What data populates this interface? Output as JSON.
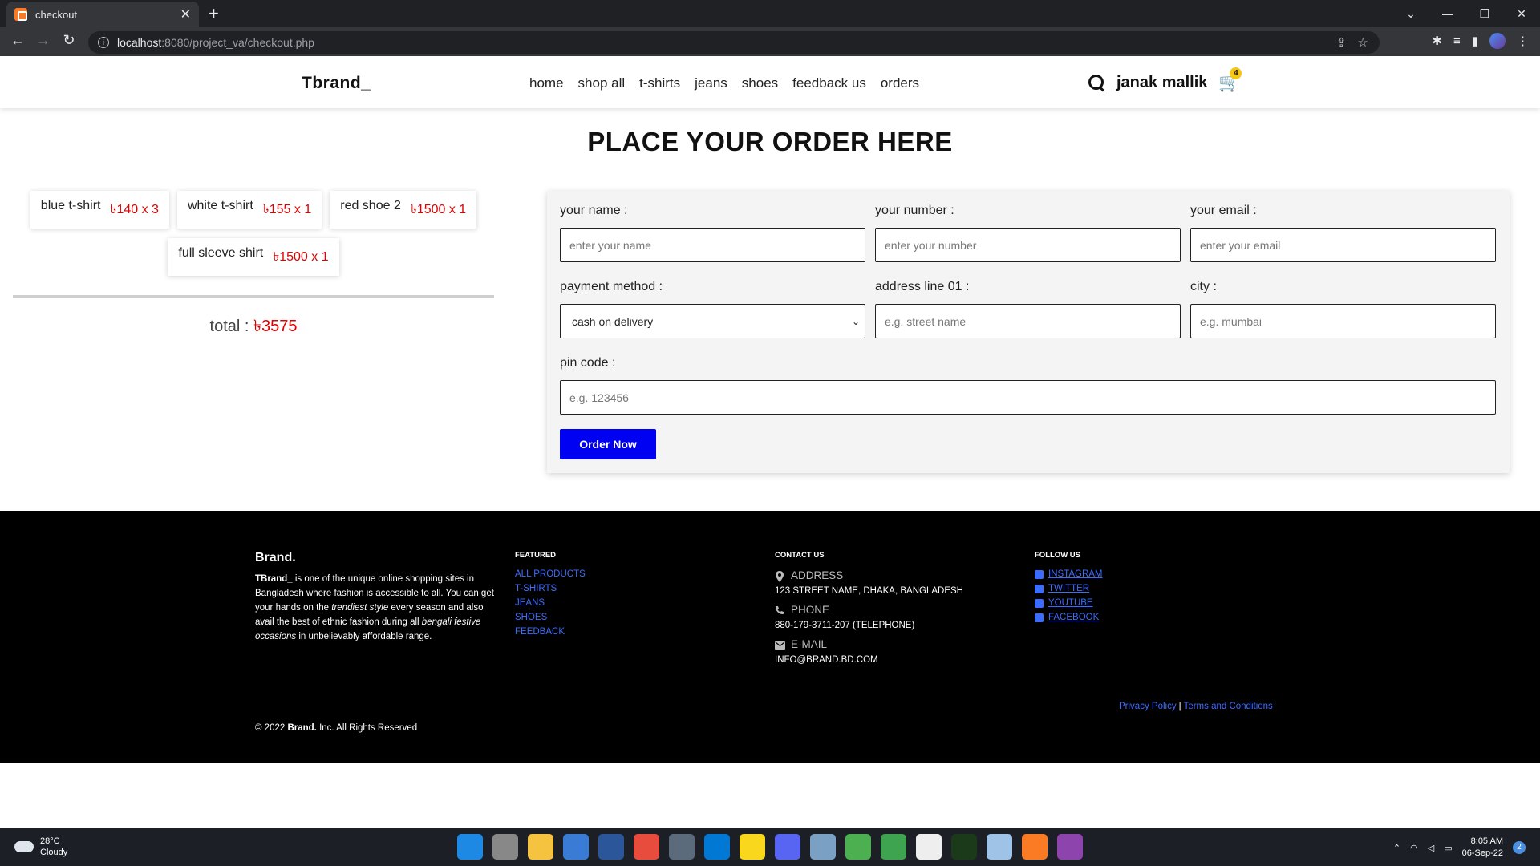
{
  "browser": {
    "tab_title": "checkout",
    "url_host": "localhost",
    "url_rest": ":8080/project_va/checkout.php"
  },
  "site": {
    "logo": "Tbrand_",
    "nav": [
      "home",
      "shop all",
      "t-shirts",
      "jeans",
      "shoes",
      "feedback us",
      "orders"
    ],
    "user_name": "janak mallik",
    "cart_count": "4"
  },
  "page": {
    "heading": "PLACE YOUR ORDER HERE"
  },
  "cart_items": [
    {
      "name": "blue t-shirt",
      "price": "৳140 x 3"
    },
    {
      "name": "white t-shirt",
      "price": "৳155 x 1"
    },
    {
      "name": "red shoe 2",
      "price": "৳1500 x 1"
    },
    {
      "name": "full sleeve shirt",
      "price": "৳1500 x 1"
    }
  ],
  "total": {
    "label": "total :",
    "amount": "৳3575"
  },
  "form": {
    "name": {
      "label": "your name :",
      "placeholder": "enter your name"
    },
    "number": {
      "label": "your number :",
      "placeholder": "enter your number"
    },
    "email": {
      "label": "your email :",
      "placeholder": "enter your email"
    },
    "payment": {
      "label": "payment method :",
      "value": "cash on delivery"
    },
    "address": {
      "label": "address line 01 :",
      "placeholder": "e.g. street name"
    },
    "city": {
      "label": "city :",
      "placeholder": "e.g. mumbai"
    },
    "pin": {
      "label": "pin code :",
      "placeholder": "e.g. 123456"
    },
    "submit": "Order Now"
  },
  "footer": {
    "brand_title": "Brand.",
    "about_strong": "TBrand_",
    "about_1": " is one of the unique online shopping sites in Bangladesh where fashion is accessible to all. You can get your hands on the ",
    "about_em1": "trendiest style",
    "about_2": " every season and also avail the best of ethnic fashion during all ",
    "about_em2": "bengali festive occasions",
    "about_3": " in unbelievably affordable range.",
    "featured_heading": "FEATURED",
    "featured_links": [
      "ALL PRODUCTS",
      "T-SHIRTS",
      "JEANS",
      "SHOES",
      "FEEDBACK"
    ],
    "contact_heading": "CONTACT US",
    "address_label": "ADDRESS",
    "address_value": "123 STREET NAME, DHAKA, BANGLADESH",
    "phone_label": "PHONE",
    "phone_value": "880-179-3711-207 (TELEPHONE)",
    "email_label": "E-MAIL",
    "email_value": "INFO@BRAND.BD.COM",
    "follow_heading": "FOLLOW US",
    "social": [
      "INSTAGRAM",
      "TWITTER",
      "YOUTUBE",
      "FACEBOOK"
    ],
    "privacy": "Privacy Policy",
    "separator": "|",
    "terms": "Terms and Conditions",
    "copy_pre": "© 2022 ",
    "copy_brand": "Brand.",
    "copy_post": " Inc. All Rights Reserved"
  },
  "taskbar": {
    "temp": "28°C",
    "weather": "Cloudy",
    "time": "8:05 AM",
    "date": "06-Sep-22",
    "notifications": "2"
  },
  "colors": {
    "accent_blue": "#0000f2",
    "price_red": "#e10000",
    "footer_link": "#3c6cff"
  }
}
